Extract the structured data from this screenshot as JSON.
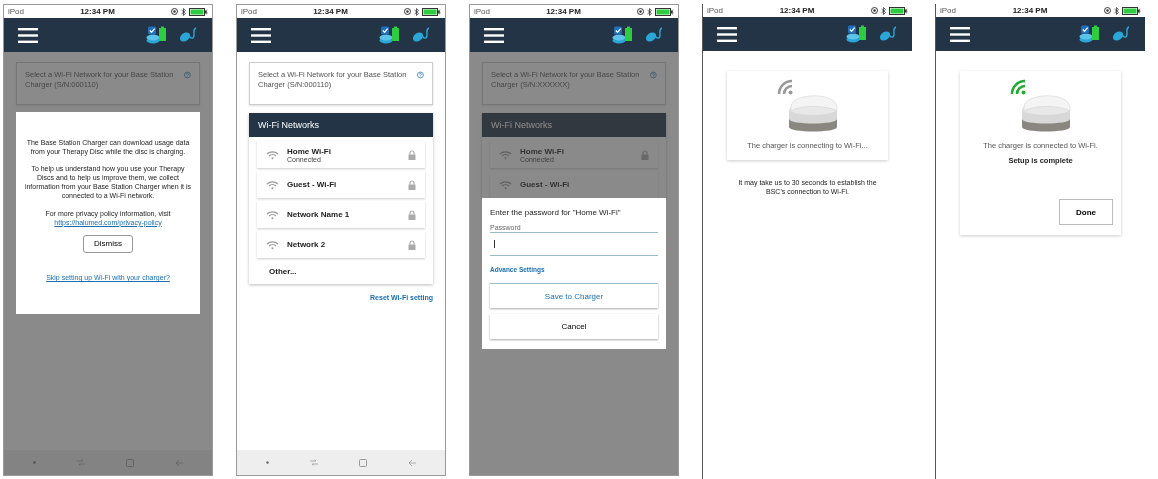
{
  "screens": [
    {
      "kind": "privacy",
      "dimmed": true,
      "nav_bar": true,
      "status_bar": {
        "carrier": "iPod",
        "time": "12:34 PM"
      },
      "prompt": "Select a Wi-Fi Network for your Base Station Charger (S/N:000110)",
      "dialog": {
        "paragraphs": [
          "The Base Station Charger can download usage data from your Therapy Disc while the disc is charging.",
          "To help us understand how you use your Therapy Discs and to help us improve them, we collect information from your Base Station Charger when it is connected to a Wi-Fi network.",
          "For more privacy policy information, visit"
        ],
        "link": "https://halumed.com/privacy-policy",
        "button": "Dismiss",
        "skip_link": "Skip setting up Wi-Fi with your charger?"
      }
    },
    {
      "kind": "networks",
      "nav_bar": true,
      "status_bar": {
        "carrier": "iPod",
        "time": "12:34 PM"
      },
      "prompt": "Select a Wi-Fi Network for your Base Station Charger (S/N:000110)",
      "list_title": "Wi-Fi Networks",
      "networks": [
        {
          "name": "Home Wi-Fi",
          "status": "Connected",
          "locked": true
        },
        {
          "name": "Guest - Wi-Fi",
          "locked": true
        },
        {
          "name": "Network Name 1",
          "locked": true
        },
        {
          "name": "Network 2",
          "locked": true
        }
      ],
      "other": "Other...",
      "reset_link": "Reset Wi-Fi setting"
    },
    {
      "kind": "password",
      "dimmed": true,
      "status_bar": {
        "carrier": "iPod",
        "time": "12:34 PM"
      },
      "prompt": "Select a Wi-Fi Network for your Base Station Charger (S/N:XXXXXX)",
      "list_title": "Wi-Fi Networks",
      "networks": [
        {
          "name": "Home Wi-Fi",
          "status": "Connected",
          "locked": true
        },
        {
          "name": "Guest - Wi-Fi",
          "locked": false
        }
      ],
      "dialog": {
        "title": "Enter the password for \"Home Wi-Fi\"",
        "field_label": "Password",
        "advanced_link": "Advance Settings",
        "save_button": "Save to Charger",
        "cancel_button": "Cancel"
      }
    },
    {
      "kind": "progress",
      "connected": false,
      "status_bar": {
        "carrier": "iPod",
        "time": "12:34 PM"
      },
      "status": "The charger is connecting to Wi-Fi...",
      "note": "It may take us to 30 seconds to establish the BSC's connection to Wi-Fi."
    },
    {
      "kind": "progress",
      "connected": true,
      "status_bar": {
        "carrier": "iPod",
        "time": "12:34 PM"
      },
      "status": "The charger is connected to Wi-Fi.",
      "complete": "Setup is complete",
      "button": "Done"
    }
  ]
}
